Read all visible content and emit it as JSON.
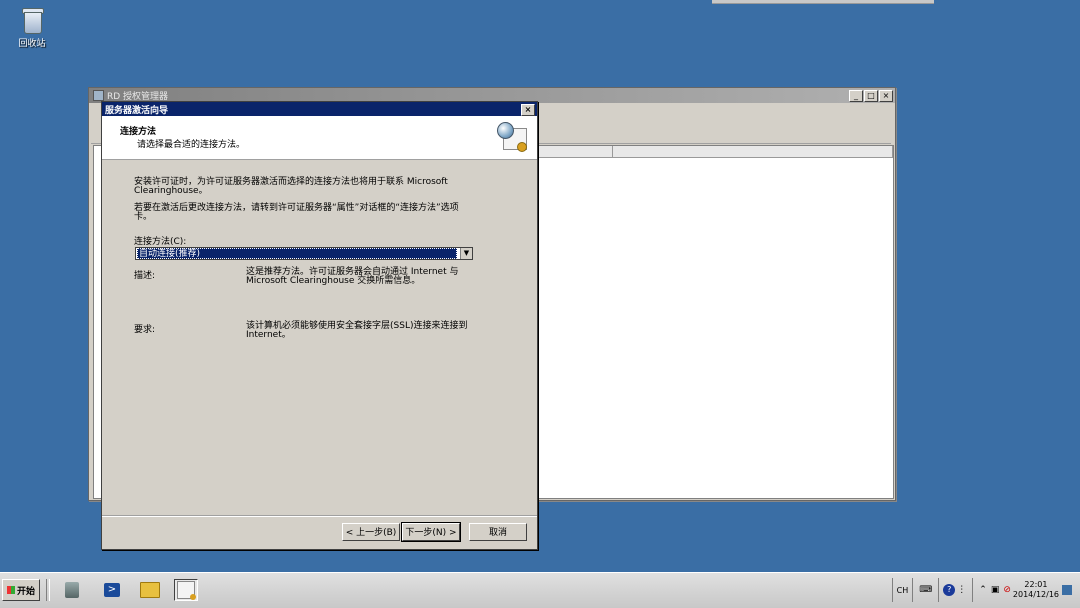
{
  "desktop": {
    "recycle_bin_label": "回收站"
  },
  "main_window": {
    "title": "RD 授权管理器",
    "min_label": "_",
    "max_label": "□",
    "close_label": "×"
  },
  "wizard": {
    "title": "服务器激活向导",
    "close_label": "×",
    "header_title": "连接方法",
    "header_subtitle": "请选择最合适的连接方法。",
    "para1": "安装许可证时，为许可证服务器激活而选择的连接方法也将用于联系 Microsoft Clearinghouse。",
    "para2": "若要在激活后更改连接方法，请转到许可证服务器“属性”对话框的“连接方法”选项卡。",
    "method_label": "连接方法(C):",
    "method_selected": "自动连接(推荐)",
    "desc_label": "描述:",
    "desc_text": "这是推荐方法。许可证服务器会自动通过 Internet 与 Microsoft Clearinghouse 交换所需信息。",
    "req_label": "要求:",
    "req_text": "该计算机必须能够使用安全套接字层(SSL)连接来连接到 Internet。",
    "btn_back": "< 上一步(B)",
    "btn_next": "下一步(N) >",
    "btn_cancel": "取消"
  },
  "taskbar": {
    "start_label": "开始",
    "lang": "CH",
    "help": "?",
    "time": "22:01",
    "date": "2014/12/16"
  }
}
